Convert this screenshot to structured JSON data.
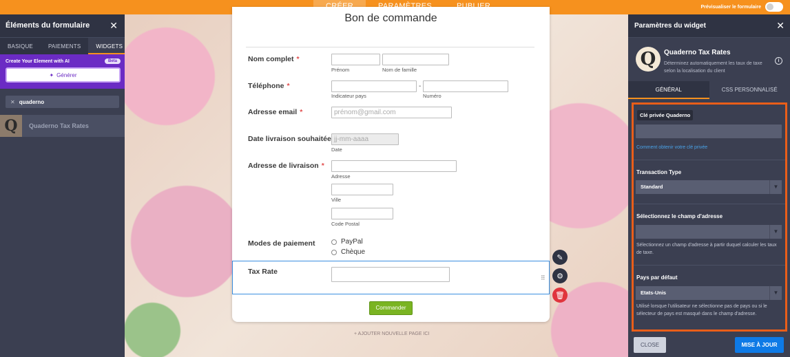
{
  "topbar": {
    "tabs": [
      "CRÉER",
      "PARAMÈTRES",
      "PUBLIER"
    ],
    "preview_label": "Prévisualiser le formulaire"
  },
  "left_panel": {
    "title": "Éléments du formulaire",
    "tabs": [
      "BASIQUE",
      "PAIEMENTS",
      "WIDGETS"
    ],
    "ai_title": "Create Your Element with AI",
    "ai_badge": "Beta",
    "ai_button": "Générer",
    "search_value": "quaderno",
    "results": [
      {
        "name": "Quaderno Tax Rates",
        "icon": "Q"
      }
    ]
  },
  "form": {
    "title": "Bon de commande",
    "fields": {
      "fullname": {
        "label": "Nom complet",
        "required": "*",
        "sub1": "Prénom",
        "sub2": "Nom de famille"
      },
      "phone": {
        "label": "Téléphone",
        "required": "*",
        "sub1": "Indicateur pays",
        "sub2": "Numéro",
        "separator": "-"
      },
      "email": {
        "label": "Adresse email",
        "required": "*",
        "placeholder": "prénom@gmail.com"
      },
      "date": {
        "label": "Date livraison souhaitée",
        "placeholder": "jj-mm-aaaa",
        "sub": "Date"
      },
      "address": {
        "label": "Adresse de livraison",
        "required": "*",
        "sub1": "Adresse",
        "sub2": "Ville",
        "sub3": "Code Postal"
      },
      "payment": {
        "label": "Modes de paiement",
        "options": [
          "PayPal",
          "Chèque"
        ]
      },
      "tax": {
        "label": "Tax Rate"
      }
    },
    "submit_label": "Commander",
    "add_page": "+ AJOUTER NOUVELLE PAGE ICI"
  },
  "right_panel": {
    "title": "Paramètres du widget",
    "widget_name": "Quaderno Tax Rates",
    "widget_icon": "Q",
    "widget_desc": "Déterminez automatiquement les taux de taxe selon la localisation du client",
    "info_glyph": "i",
    "tabs": [
      "GÉNÉRAL",
      "CSS PERSONNALISÉ"
    ],
    "private_key_label": "Clé privée Quaderno",
    "private_key_link": "Comment obtenir votre clé privée",
    "transaction_label": "Transaction Type",
    "transaction_value": "Standard",
    "address_field_label": "Sélectionnez le champ d'adresse",
    "address_field_value": "",
    "address_field_help": "Sélectionnez un champ d'adresse à partir duquel calculer les taux de taxe.",
    "country_label": "Pays par défaut",
    "country_value": "Etats-Unis",
    "country_help": "Utilisé lorsque l'utilisateur ne sélectionne pas de pays ou si le sélecteur de pays est masqué dans le champ d'adresse.",
    "close_button": "CLOSE",
    "update_button": "MISE À JOUR"
  },
  "colors": {
    "accent": "#f6911e",
    "panel": "#3b3f51",
    "ai_purple": "#6b2bc4",
    "highlight_border": "#ea5e19",
    "primary_button": "#0e7ae6",
    "submit_green": "#7ab422"
  }
}
